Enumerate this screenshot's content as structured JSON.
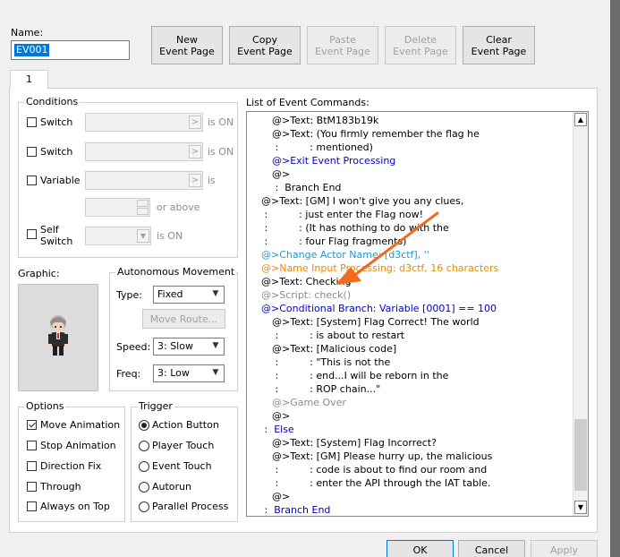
{
  "name_label": "Name:",
  "name_value": "EV001",
  "toolbar": {
    "new_page": [
      "New",
      "Event Page"
    ],
    "copy_page": [
      "Copy",
      "Event Page"
    ],
    "paste_page": [
      "Paste",
      "Event Page"
    ],
    "delete_page": [
      "Delete",
      "Event Page"
    ],
    "clear_page": [
      "Clear",
      "Event Page"
    ]
  },
  "page_tab": "1",
  "conditions": {
    "title": "Conditions",
    "switch1": "Switch",
    "switch2": "Switch",
    "variable": "Variable",
    "self_switch": [
      "Self",
      "Switch"
    ],
    "is_on": "is ON",
    "is": "is",
    "or_above": "or above",
    "ellipsis": ">"
  },
  "graphic_label": "Graphic:",
  "autonomous": {
    "title": "Autonomous Movement",
    "type_label": "Type:",
    "type_value": "Fixed",
    "move_route": "Move Route...",
    "speed_label": "Speed:",
    "speed_value": "3: Slow",
    "freq_label": "Freq:",
    "freq_value": "3: Low"
  },
  "options": {
    "title": "Options",
    "items": [
      {
        "label": "Move Animation",
        "checked": true
      },
      {
        "label": "Stop Animation",
        "checked": false
      },
      {
        "label": "Direction Fix",
        "checked": false
      },
      {
        "label": "Through",
        "checked": false
      },
      {
        "label": "Always on Top",
        "checked": false
      }
    ]
  },
  "trigger": {
    "title": "Trigger",
    "items": [
      {
        "label": "Action Button",
        "selected": true
      },
      {
        "label": "Player Touch",
        "selected": false
      },
      {
        "label": "Event Touch",
        "selected": false
      },
      {
        "label": "Autorun",
        "selected": false
      },
      {
        "label": "Parallel Process",
        "selected": false
      }
    ]
  },
  "commands": {
    "title": "List of Event Commands:",
    "colors": {
      "default": "#000000",
      "blue": "#0000cc",
      "teal": "#2299cc",
      "orange": "#ee8800",
      "gray": "#8a8a8a"
    },
    "lines": [
      {
        "text": "@>Text: BtM183b19k",
        "indent": 18,
        "color": "default"
      },
      {
        "text": "@>Text: (You firmly remember the flag he",
        "indent": 18,
        "color": "default"
      },
      {
        "text": " :          : mentioned)",
        "indent": 18,
        "color": "default"
      },
      {
        "text": "@>Exit Event Processing",
        "indent": 18,
        "color": "blue"
      },
      {
        "text": "@>",
        "indent": 18,
        "color": "default"
      },
      {
        "text": " :  Branch End",
        "indent": 18,
        "color": "default"
      },
      {
        "text": "@>Text: [GM] I won't give you any clues,",
        "indent": 6,
        "color": "default"
      },
      {
        "text": " :          : just enter the Flag now!",
        "indent": 6,
        "color": "default"
      },
      {
        "text": " :          : (It has nothing to do with the",
        "indent": 6,
        "color": "default"
      },
      {
        "text": " :          : four Flag fragments)",
        "indent": 6,
        "color": "default"
      },
      {
        "text": "@>Change Actor Name: [d3ctf], ''",
        "indent": 6,
        "color": "teal"
      },
      {
        "text": "@>Name Input Processing: d3ctf, 16 characters",
        "indent": 6,
        "color": "orange"
      },
      {
        "text": "@>Text: Checking",
        "indent": 6,
        "color": "default"
      },
      {
        "text": "@>Script: check()",
        "indent": 6,
        "color": "gray"
      },
      {
        "text": "@>Conditional Branch: Variable [0001] == 100",
        "indent": 6,
        "color": "blue"
      },
      {
        "text": "@>Text: [System] Flag Correct! The world",
        "indent": 18,
        "color": "default"
      },
      {
        "text": " :          : is about to restart",
        "indent": 18,
        "color": "default"
      },
      {
        "text": "@>Text: [Malicious code]",
        "indent": 18,
        "color": "default"
      },
      {
        "text": " :          : \"This is not the",
        "indent": 18,
        "color": "default"
      },
      {
        "text": " :          : end...I will be reborn in the",
        "indent": 18,
        "color": "default"
      },
      {
        "text": " :          : ROP chain...\"",
        "indent": 18,
        "color": "default"
      },
      {
        "text": "@>Game Over",
        "indent": 18,
        "color": "gray"
      },
      {
        "text": "@>",
        "indent": 18,
        "color": "default"
      },
      {
        "text": " :  Else",
        "indent": 6,
        "color": "blue"
      },
      {
        "text": "@>Text: [System] Flag Incorrect?",
        "indent": 18,
        "color": "default"
      },
      {
        "text": "@>Text: [GM] Please hurry up, the malicious",
        "indent": 18,
        "color": "default"
      },
      {
        "text": " :          : code is about to find our room and",
        "indent": 18,
        "color": "default"
      },
      {
        "text": " :          : enter the API through the IAT table.",
        "indent": 18,
        "color": "default"
      },
      {
        "text": "@>",
        "indent": 18,
        "color": "default"
      },
      {
        "text": " :  Branch End",
        "indent": 6,
        "color": "blue"
      }
    ]
  },
  "footer": {
    "ok": "OK",
    "cancel": "Cancel",
    "apply": "Apply"
  },
  "annotation": {
    "color": "#f26b1d"
  }
}
